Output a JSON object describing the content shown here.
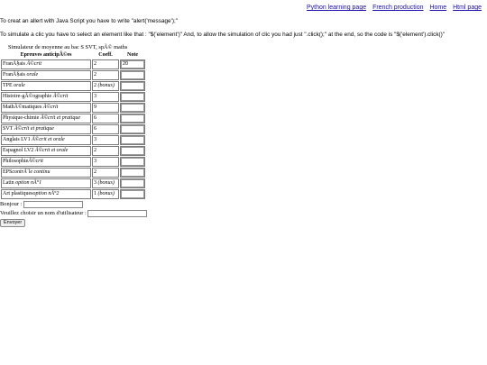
{
  "nav": {
    "links": [
      "Python learning page",
      "French production",
      "Home",
      "Html page"
    ]
  },
  "intro": {
    "line1": "To creat an allert with Java Script you have to write \"alert('message');\"",
    "line2": "To simulate a clic you have to select an element like that : \"$('element')\" And, to allow the simulation of clic you had just \".click();\" at the end, so the code is \"$('element').click()\""
  },
  "simulator": {
    "caption": "Simulateur de moyenne au bac S SVT, spÃ© maths",
    "headers": [
      "Epreuves anticipÃ©es",
      "Coeff.",
      "Note"
    ],
    "rows": [
      {
        "subject": "FranÃ§ais ",
        "detail": "Ã©crit",
        "coeff": "2",
        "note": "20"
      },
      {
        "subject": "FranÃ§ais ",
        "detail": "orale",
        "coeff": "2",
        "note": ""
      },
      {
        "subject": "TPE ",
        "detail": "orale",
        "coeff": "2 (bonus)",
        "note": ""
      },
      {
        "subject": "Histoire-gÃ©ographie ",
        "detail": "Ã©crit",
        "coeff": "3",
        "note": ""
      },
      {
        "subject": "MathÃ©matiques ",
        "detail": "Ã©crit",
        "coeff": "9",
        "note": ""
      },
      {
        "subject": "Physique-chimie ",
        "detail": "Ã©crit et pratique",
        "coeff": "6",
        "note": ""
      },
      {
        "subject": "SVT ",
        "detail": "Ã©crit et pratique",
        "coeff": "6",
        "note": ""
      },
      {
        "subject": "Anglais LV1 ",
        "detail": "Ã©crit et orale",
        "coeff": "3",
        "note": ""
      },
      {
        "subject": "Espagnol LV2 ",
        "detail": "Ã©crit et orale",
        "coeff": "2",
        "note": ""
      },
      {
        "subject": "Philosophie",
        "detail": "Ã©crit",
        "coeff": "3",
        "note": ""
      },
      {
        "subject": "EPS",
        "detail": "contrÃ´le continu",
        "coeff": "2",
        "note": ""
      },
      {
        "subject": "Latin ",
        "detail": "option nÂ°1",
        "coeff": "3 (bonus)",
        "note": ""
      },
      {
        "subject": "Art plastiques",
        "detail": "option nÂ°2",
        "coeff": "1 (bonus)",
        "note": ""
      }
    ]
  },
  "form": {
    "bonjour_label": "Bonjour : ",
    "username_label": "Veuillez choisir un nom d'utilisateur : ",
    "send_label": "Envoyer"
  }
}
